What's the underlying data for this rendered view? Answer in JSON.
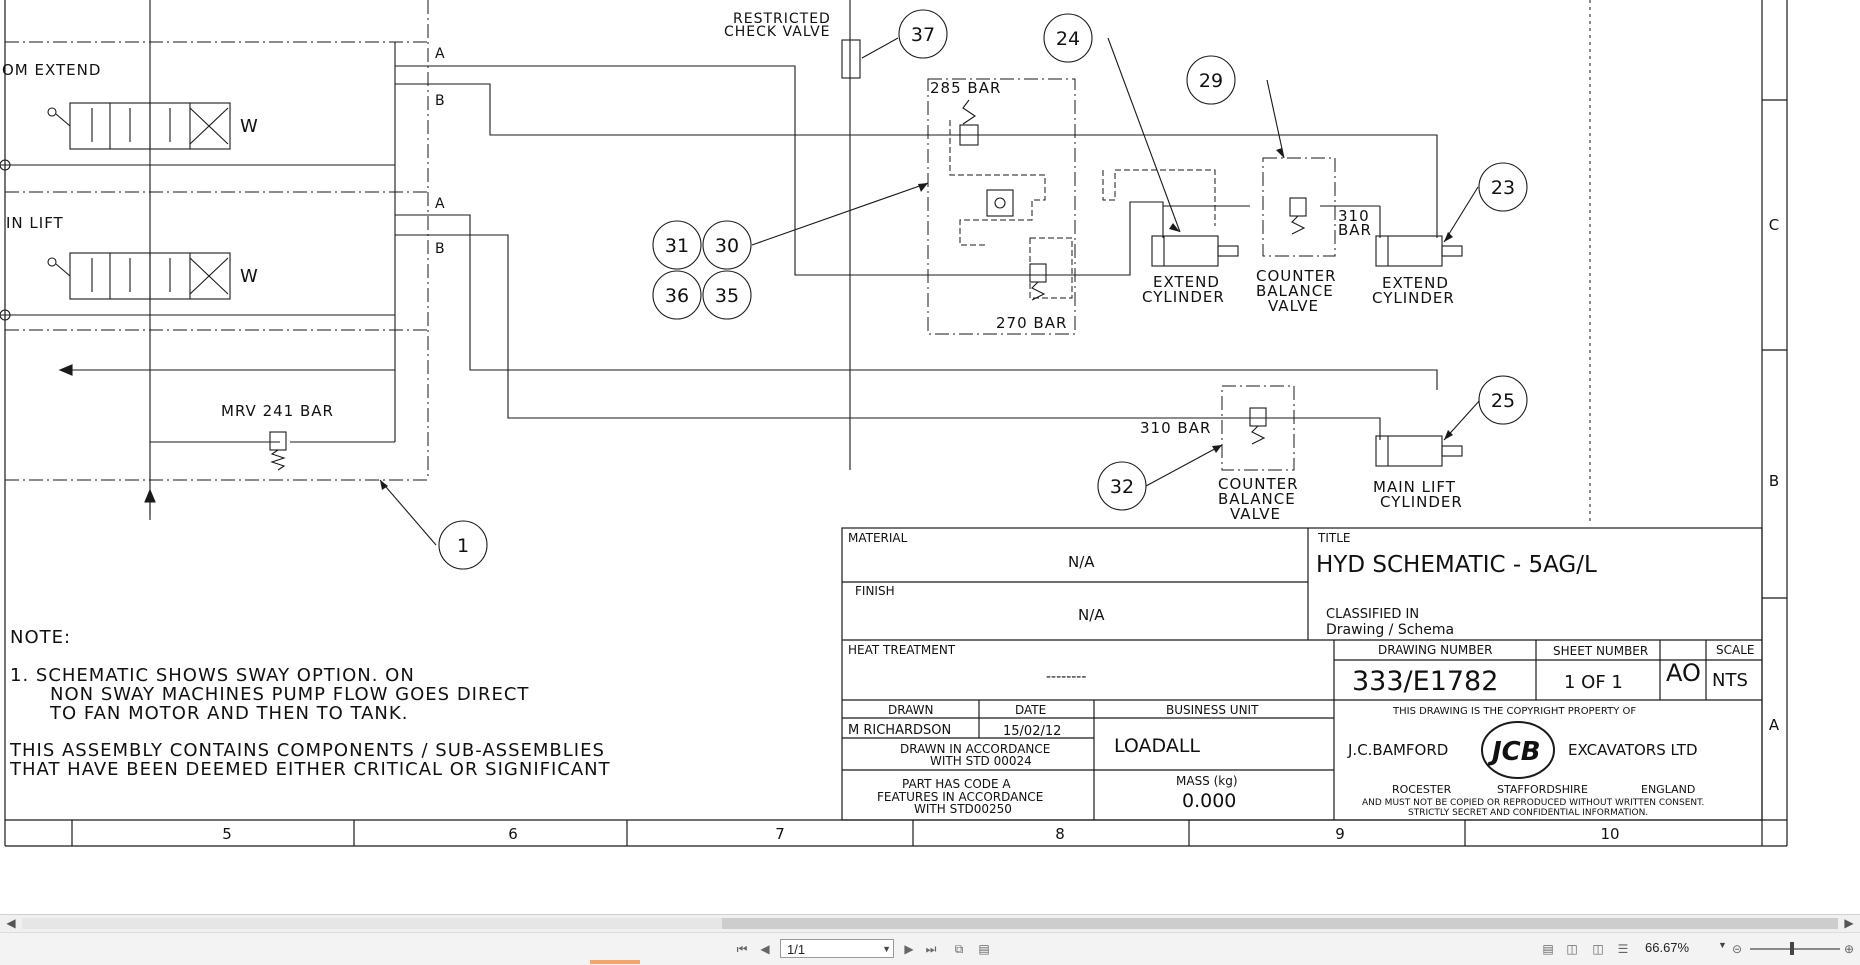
{
  "drawing": {
    "labels": {
      "boom_extend": "OM EXTEND",
      "main_lift": "IN LIFT",
      "port_a1": "A",
      "port_b1": "B",
      "port_a2": "A",
      "port_b2": "B",
      "spool_w1": "W",
      "spool_w2": "W",
      "mrv": "MRV 241 BAR",
      "restricted_check_1": "RESTRICTED",
      "restricted_check_2": "CHECK VALVE",
      "bar_285": "285 BAR",
      "bar_270": "270 BAR",
      "bar_310_top_1": "310",
      "bar_310_top_2": "BAR",
      "bar_310_low": "310 BAR",
      "extend_cyl_left_1": "EXTEND",
      "extend_cyl_left_2": "CYLINDER",
      "extend_cyl_right_1": "EXTEND",
      "extend_cyl_right_2": "CYLINDER",
      "cbv_top_1": "COUNTER",
      "cbv_top_2": "BALANCE",
      "cbv_top_3": "VALVE",
      "cbv_low_1": "COUNTER",
      "cbv_low_2": "BALANCE",
      "cbv_low_3": "VALVE",
      "main_lift_cyl_1": "MAIN LIFT",
      "main_lift_cyl_2": "CYLINDER"
    },
    "balloons": {
      "b1": "1",
      "b23": "23",
      "b24": "24",
      "b25": "25",
      "b29": "29",
      "b30": "30",
      "b31": "31",
      "b32": "32",
      "b35": "35",
      "b36": "36",
      "b37": "37"
    },
    "notes": {
      "heading": "NOTE:",
      "n1_l1": "1. SCHEMATIC SHOWS SWAY OPTION. ON",
      "n1_l2": "NON SWAY MACHINES PUMP FLOW GOES DIRECT",
      "n1_l3": "TO FAN MOTOR AND THEN TO TANK.",
      "n2_l1": "THIS ASSEMBLY CONTAINS COMPONENTS / SUB-ASSEMBLIES",
      "n2_l2": "THAT HAVE BEEN DEEMED EITHER CRITICAL OR SIGNIFICANT"
    },
    "zones_bottom": [
      "5",
      "6",
      "7",
      "8",
      "9",
      "10"
    ],
    "zones_side": [
      "C",
      "B",
      "A"
    ]
  },
  "title_block": {
    "material_label": "MATERIAL",
    "material_value": "N/A",
    "finish_label": "FINISH",
    "finish_value": "N/A",
    "title_label": "TITLE",
    "title_value": "HYD SCHEMATIC - 5AG/L",
    "classified_label": "CLASSIFIED IN",
    "classified_value": "Drawing / Schema",
    "heat_label": "HEAT TREATMENT",
    "heat_value": "--------",
    "drawing_number_label": "DRAWING NUMBER",
    "drawing_number": "333/E1782",
    "sheet_number_label": "SHEET NUMBER",
    "sheet_number": "1 OF 1",
    "size": "AO",
    "scale_label": "SCALE",
    "scale": "NTS",
    "drawn_label": "DRAWN",
    "date_label": "DATE",
    "business_unit_label": "BUSINESS UNIT",
    "drawn_by": "M RICHARDSON",
    "date": "15/02/12",
    "business_unit": "LOADALL",
    "std_l1": "DRAWN IN ACCORDANCE",
    "std_l2": "WITH STD 00024",
    "code_l1": "PART HAS CODE A",
    "code_l2": "FEATURES IN ACCORDANCE",
    "code_l3": "WITH STD00250",
    "mass_label": "MASS (kg)",
    "mass": "0.000",
    "copyright": "THIS DRAWING IS THE COPYRIGHT PROPERTY OF",
    "company_left": "J.C.BAMFORD",
    "company_right": "EXCAVATORS LTD",
    "logo": "JCB",
    "loc_1": "ROCESTER",
    "loc_2": "STAFFORDSHIRE",
    "loc_3": "ENGLAND",
    "disclaimer_1": "AND MUST NOT BE COPIED OR REPRODUCED WITHOUT WRITTEN CONSENT.",
    "disclaimer_2": "STRICTLY SECRET AND CONFIDENTIAL INFORMATION."
  },
  "viewer": {
    "page_indicator": "1/1",
    "zoom": "66.67%",
    "icons": [
      "first-page-icon",
      "prev-page-icon",
      "next-page-icon",
      "last-page-icon",
      "copy-icon",
      "fit-icon",
      "single-page-icon",
      "continuous-icon",
      "two-page-icon",
      "two-continuous-icon",
      "zoom-out-icon",
      "zoom-in-icon"
    ]
  }
}
